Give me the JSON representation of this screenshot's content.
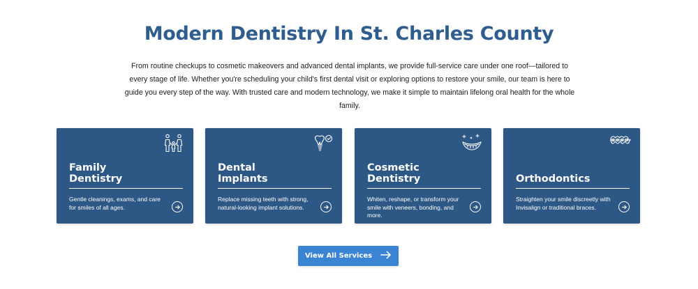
{
  "section": {
    "heading": "Modern Dentistry In St. Charles County",
    "intro": "From routine checkups to cosmetic makeovers and advanced dental implants, we provide full-service care under one roof—tailored to every stage of life. Whether you're scheduling your child's first dental visit or exploring options to restore your smile, our team is here to guide you every step of the way. With trusted care and modern technology, we make it simple to maintain lifelong oral health for the whole family."
  },
  "services": [
    {
      "title_line1": "Family",
      "title_line2": "Dentistry",
      "description": "Gentle cleanings, exams, and care for smiles of all ages.",
      "icon": "family-icon"
    },
    {
      "title_line1": "Dental",
      "title_line2": "Implants",
      "description": "Replace missing teeth with strong, natural-looking implant solutions.",
      "icon": "implant-icon"
    },
    {
      "title_line1": "Cosmetic",
      "title_line2": "Dentistry",
      "description": "Whiten, reshape, or transform your smile with veneers, bonding, and more.",
      "icon": "smile-sparkle-icon"
    },
    {
      "title_line1": "Orthodontics",
      "title_line2": "",
      "description": "Straighten your smile discreetly with Invisalign or traditional braces.",
      "icon": "braces-icon"
    }
  ],
  "cta": {
    "label": "View All Services",
    "icon": "arrow-right-icon"
  },
  "colors": {
    "heading": "#2f5d8e",
    "card_background": "#2d5784",
    "button_background": "#3b84d4",
    "text": "#1c1c1c"
  }
}
